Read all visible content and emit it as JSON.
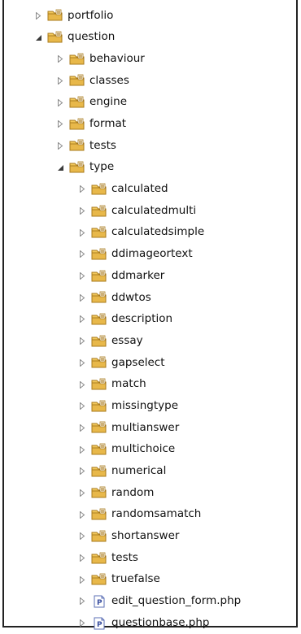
{
  "tree": [
    {
      "label": "portfolio",
      "level": 0,
      "expanded": false,
      "kind": "folder"
    },
    {
      "label": "question",
      "level": 0,
      "expanded": true,
      "kind": "folder"
    },
    {
      "label": "behaviour",
      "level": 1,
      "expanded": false,
      "kind": "folder"
    },
    {
      "label": "classes",
      "level": 1,
      "expanded": false,
      "kind": "folder"
    },
    {
      "label": "engine",
      "level": 1,
      "expanded": false,
      "kind": "folder"
    },
    {
      "label": "format",
      "level": 1,
      "expanded": false,
      "kind": "folder"
    },
    {
      "label": "tests",
      "level": 1,
      "expanded": false,
      "kind": "folder"
    },
    {
      "label": "type",
      "level": 1,
      "expanded": true,
      "kind": "folder"
    },
    {
      "label": "calculated",
      "level": 2,
      "expanded": false,
      "kind": "folder"
    },
    {
      "label": "calculatedmulti",
      "level": 2,
      "expanded": false,
      "kind": "folder"
    },
    {
      "label": "calculatedsimple",
      "level": 2,
      "expanded": false,
      "kind": "folder"
    },
    {
      "label": "ddimageortext",
      "level": 2,
      "expanded": false,
      "kind": "folder"
    },
    {
      "label": "ddmarker",
      "level": 2,
      "expanded": false,
      "kind": "folder"
    },
    {
      "label": "ddwtos",
      "level": 2,
      "expanded": false,
      "kind": "folder"
    },
    {
      "label": "description",
      "level": 2,
      "expanded": false,
      "kind": "folder"
    },
    {
      "label": "essay",
      "level": 2,
      "expanded": false,
      "kind": "folder"
    },
    {
      "label": "gapselect",
      "level": 2,
      "expanded": false,
      "kind": "folder"
    },
    {
      "label": "match",
      "level": 2,
      "expanded": false,
      "kind": "folder"
    },
    {
      "label": "missingtype",
      "level": 2,
      "expanded": false,
      "kind": "folder"
    },
    {
      "label": "multianswer",
      "level": 2,
      "expanded": false,
      "kind": "folder"
    },
    {
      "label": "multichoice",
      "level": 2,
      "expanded": false,
      "kind": "folder"
    },
    {
      "label": "numerical",
      "level": 2,
      "expanded": false,
      "kind": "folder"
    },
    {
      "label": "random",
      "level": 2,
      "expanded": false,
      "kind": "folder"
    },
    {
      "label": "randomsamatch",
      "level": 2,
      "expanded": false,
      "kind": "folder"
    },
    {
      "label": "shortanswer",
      "level": 2,
      "expanded": false,
      "kind": "folder"
    },
    {
      "label": "tests",
      "level": 2,
      "expanded": false,
      "kind": "folder"
    },
    {
      "label": "truefalse",
      "level": 2,
      "expanded": false,
      "kind": "folder"
    },
    {
      "label": "edit_question_form.php",
      "level": 2,
      "expanded": false,
      "kind": "php-file"
    },
    {
      "label": "questionbase.php",
      "level": 2,
      "expanded": false,
      "kind": "php-file"
    }
  ],
  "colors": {
    "folder": "#e8b84a",
    "folder_dark": "#b9862a",
    "php_file": "#5b6fb5"
  }
}
